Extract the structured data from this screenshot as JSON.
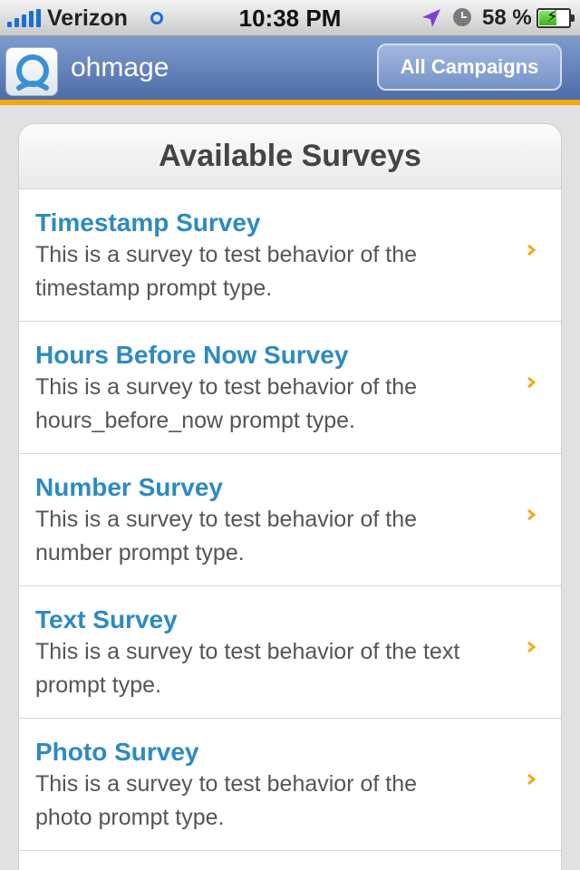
{
  "status_bar": {
    "carrier": "Verizon",
    "time": "10:38 PM",
    "battery_percent": "58 %",
    "battery_level": 0.58
  },
  "nav": {
    "app_name": "ohmage",
    "all_campaigns_label": "All Campaigns"
  },
  "surveys": {
    "header": "Available Surveys",
    "items": [
      {
        "title": "Timestamp Survey",
        "description": "This is a survey to test behavior of the timestamp prompt type."
      },
      {
        "title": "Hours Before Now Survey",
        "description": "This is a survey to test behavior of the hours_before_now prompt type."
      },
      {
        "title": "Number Survey",
        "description": "This is a survey to test behavior of the number prompt type."
      },
      {
        "title": "Text Survey",
        "description": "This is a survey to test behavior of the text prompt type."
      },
      {
        "title": "Photo Survey",
        "description": "This is a survey to test behavior of the photo prompt type."
      }
    ]
  },
  "colors": {
    "nav_bar": "#5b79b3",
    "accent": "#f4a90f",
    "survey_title": "#2d8ac2"
  },
  "icons": [
    "signal-bars-icon",
    "wifi-icon",
    "location-arrow-icon",
    "alarm-clock-icon",
    "battery-icon",
    "ohmage-logo-icon",
    "chevron-right-icon"
  ]
}
